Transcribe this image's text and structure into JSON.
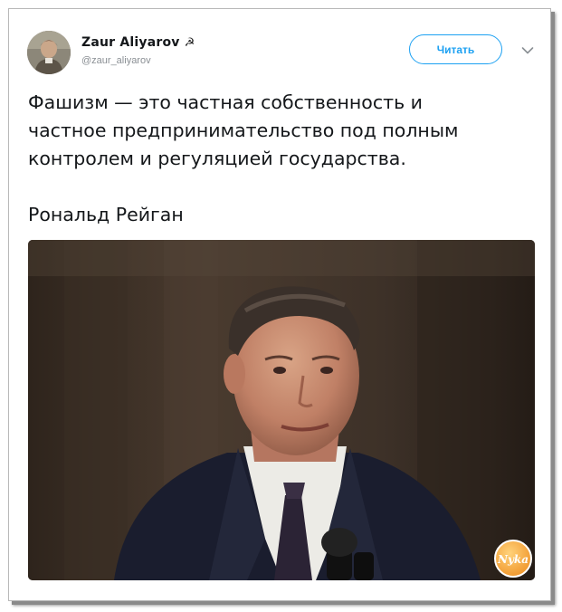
{
  "author": {
    "name": "Zaur Aliyarov",
    "symbol": "☭",
    "handle": "@zaur_aliyarov"
  },
  "follow_label": "Читать",
  "tweet": {
    "text": "Фашизм — это частная собственность и\nчастное предпринимательство под полным\nконтролем и регуляцией государства.\n\nРональд Рейган"
  },
  "watermark": "Nyka",
  "colors": {
    "accent": "#1da1f2",
    "text": "#14171a",
    "muted": "#8a8f94",
    "watermark": "#f3a23a"
  },
  "icons": {
    "caret": "chevron-down-icon"
  }
}
